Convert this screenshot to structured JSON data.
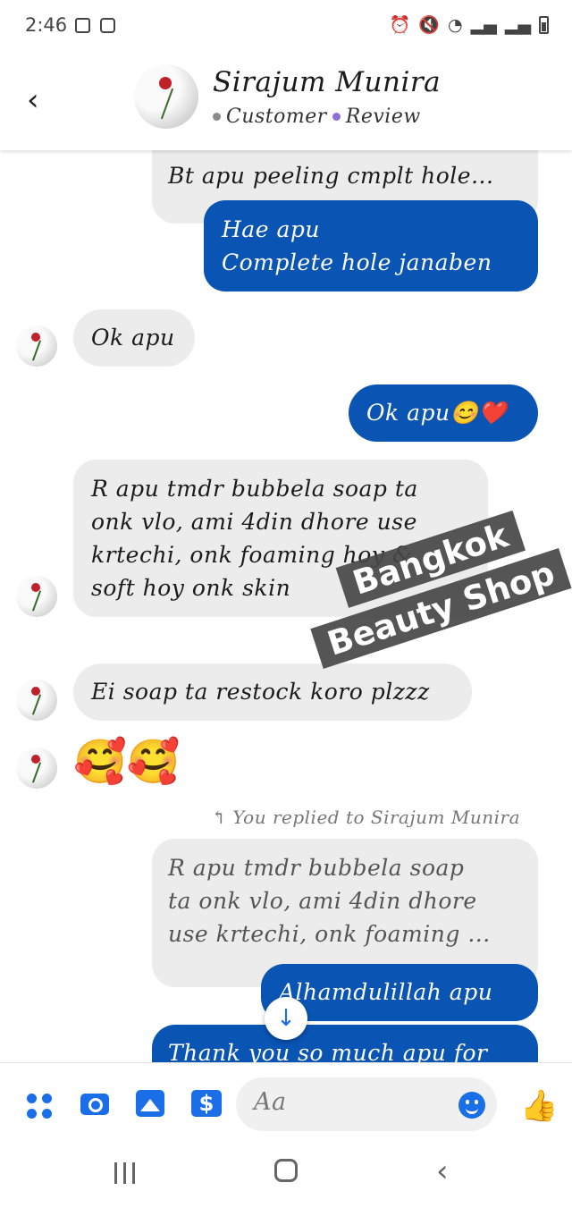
{
  "status_bar": {
    "time": "2:46"
  },
  "header": {
    "back_glyph": "‹",
    "contact_name": "Sirajum Munira",
    "label_1": "Customer",
    "label_2": "Review",
    "label_1_dot_color": "#8a8a8a",
    "label_2_dot_color": "#8f6fd1"
  },
  "messages": [
    {
      "side": "received",
      "text_lines": [
        "Bt apu peeling cmplt hole..."
      ]
    },
    {
      "side": "sent",
      "text_lines": [
        "Hae apu",
        "Complete hole janaben"
      ]
    },
    {
      "side": "received",
      "text_lines": [
        "Ok apu"
      ]
    },
    {
      "side": "sent",
      "text_lines": [
        "Ok apu😊❤️"
      ]
    },
    {
      "side": "received",
      "text_lines": [
        "R apu tmdr bubbela soap ta",
        "onk vlo, ami 4din dhore use",
        "krtechi, onk foaming hoy &",
        "soft hoy onk skin"
      ]
    },
    {
      "side": "received",
      "text_lines": [
        "Ei soap ta restock koro plzzz"
      ]
    },
    {
      "side": "received",
      "emoji": "🥰🥰"
    },
    {
      "side": "sent",
      "reply_label": "You replied to Sirajum Munira",
      "quoted_lines": [
        "R apu tmdr bubbela soap",
        "ta onk vlo, ami 4din dhore",
        "use krtechi, onk foaming ..."
      ],
      "text_lines": [
        "Alhamdulillah apu"
      ]
    },
    {
      "side": "sent",
      "text_lines": [
        "Thank you so much apu for"
      ]
    }
  ],
  "watermark": {
    "line_1": "Bangkok",
    "line_2": "Beauty Shop"
  },
  "scroll_button": {
    "glyph": "↓"
  },
  "composer": {
    "placeholder": "Aa",
    "pay_glyph": "$",
    "like_glyph": "👍"
  },
  "nav_bar": {
    "back_glyph": "‹"
  },
  "colors": {
    "sent_bubble": "#0a54b4",
    "received_bubble": "#ececec",
    "accent": "#1a6fe8"
  }
}
